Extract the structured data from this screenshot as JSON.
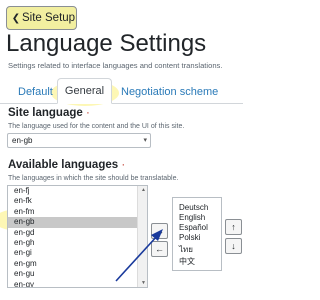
{
  "back_button": {
    "label": "Site Setup",
    "icon": "chevron-left-icon"
  },
  "page": {
    "title": "Language Settings",
    "description": "Settings related to interface languages and content translations."
  },
  "tabs": [
    {
      "label": "Default"
    },
    {
      "label": "General",
      "active": true
    },
    {
      "label": "Negotiation scheme"
    }
  ],
  "site_language": {
    "label": "Site language",
    "required_marker": "·",
    "description": "The language used for the content and the UI of this site.",
    "value": "en-gb"
  },
  "available_languages": {
    "label": "Available languages",
    "required_marker": "·",
    "description": "The languages in which the site should be translatable.",
    "items": [
      "en-fj",
      "en-fk",
      "en-fm",
      "en-gb",
      "en-gd",
      "en-gh",
      "en-gi",
      "en-gm",
      "en-gu",
      "en-gy"
    ],
    "selected": "en-gb",
    "enabled": [
      "Deutsch",
      "English",
      "Español",
      "Polski",
      "ไทย",
      "中文"
    ]
  },
  "buttons": {
    "add": "→",
    "remove": "←",
    "up": "↑",
    "down": "↓"
  },
  "colors": {
    "highlight": "#fdf6a8",
    "link": "#2a7ab8",
    "selection": "#c8c8c8",
    "arrow": "#1a3a9c"
  }
}
